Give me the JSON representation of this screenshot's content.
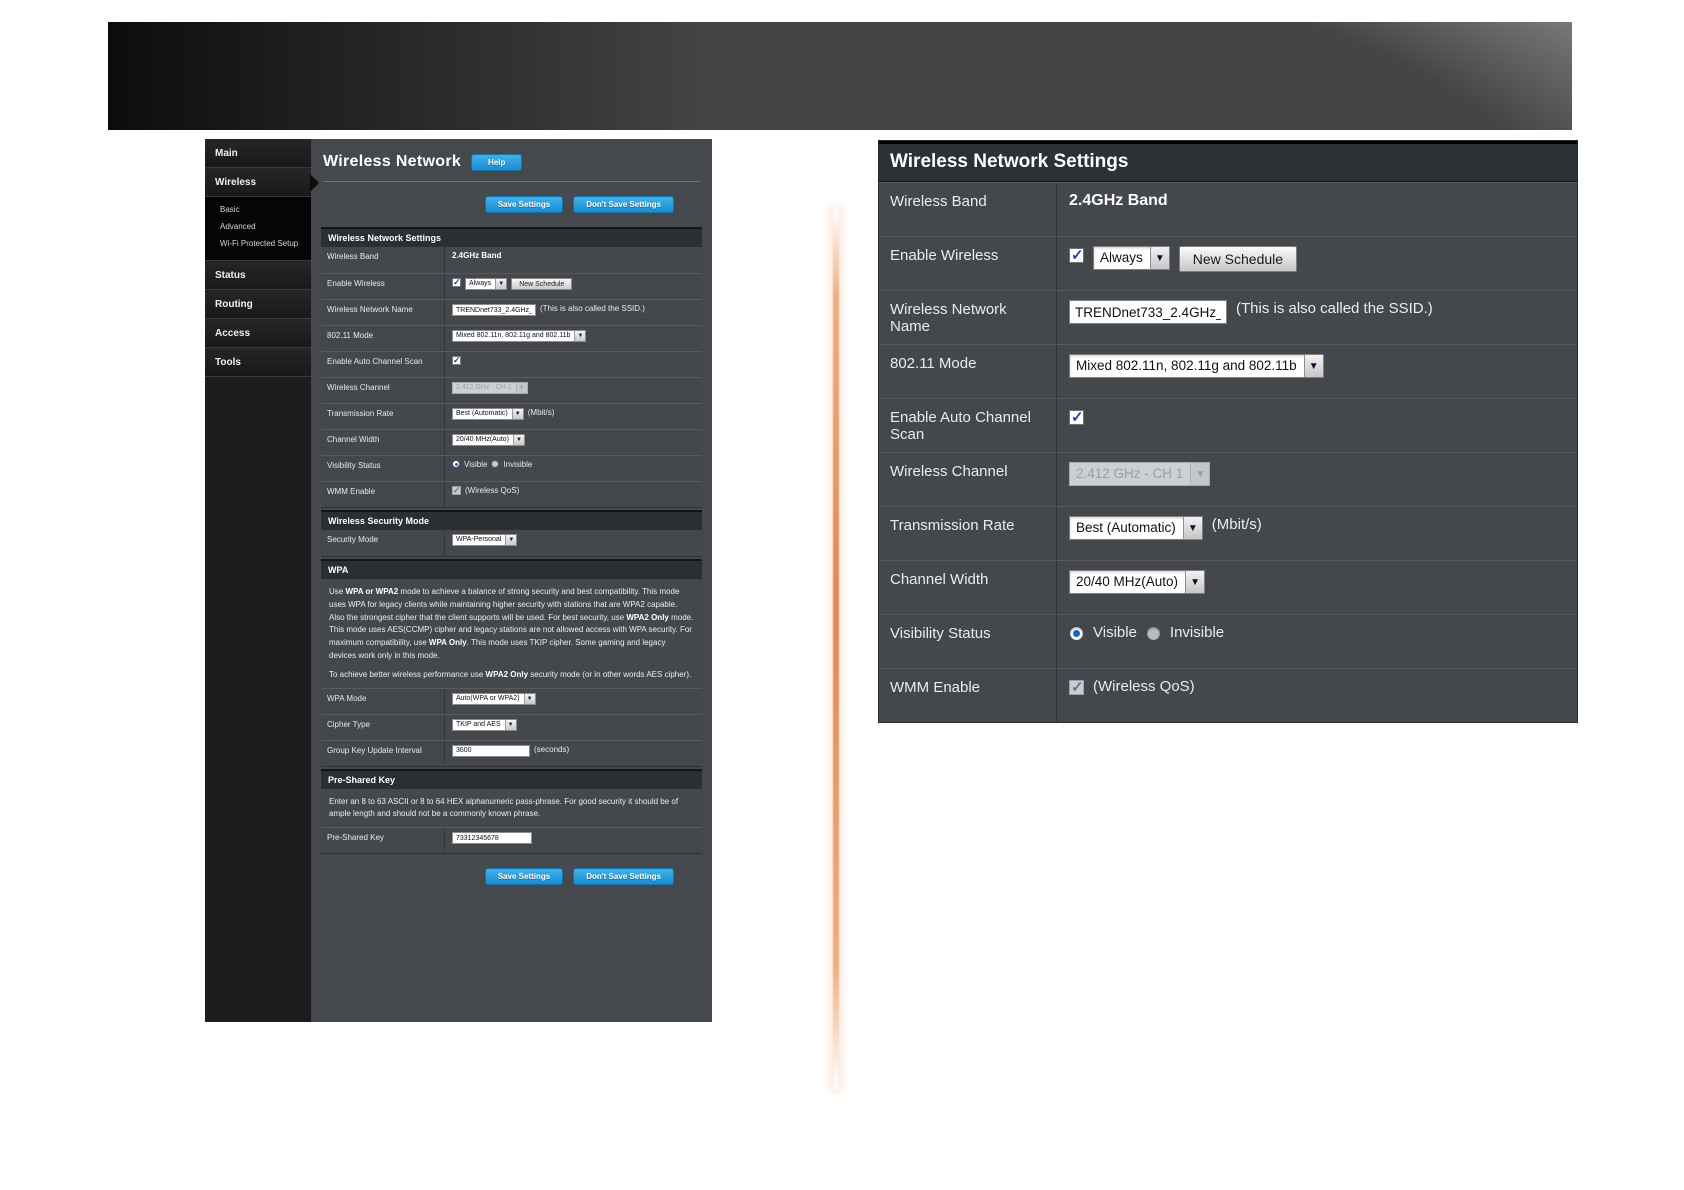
{
  "colors": {
    "accent_blue": "#2196d6",
    "panel_bg": "#44484d",
    "header_bg": "#2d3035",
    "stripe_orange": "#df8a50"
  },
  "sidebar": {
    "items": [
      {
        "label": "Main"
      },
      {
        "label": "Wireless"
      },
      {
        "label": "Basic"
      },
      {
        "label": "Advanced"
      },
      {
        "label": "Wi-Fi Protected Setup"
      },
      {
        "label": "Status"
      },
      {
        "label": "Routing"
      },
      {
        "label": "Access"
      },
      {
        "label": "Tools"
      }
    ]
  },
  "page": {
    "title": "Wireless Network",
    "help_label": "Help",
    "save_label": "Save Settings",
    "dont_save_label": "Don't Save Settings"
  },
  "settings": {
    "header": "Wireless Network Settings",
    "wireless_band": {
      "label": "Wireless Band",
      "value": "2.4GHz Band"
    },
    "enable_wireless": {
      "label": "Enable Wireless",
      "checked": true,
      "dropdown_value": "Always",
      "schedule_button": "New Schedule"
    },
    "network_name": {
      "label": "Wireless Network Name",
      "value": "TRENDnet733_2.4GHz_",
      "note": "(This is also called the SSID.)"
    },
    "mode_80211": {
      "label": "802.11 Mode",
      "value": "Mixed 802.11n, 802.11g and 802.11b"
    },
    "auto_channel_scan": {
      "label": "Enable Auto Channel Scan",
      "checked": true
    },
    "wireless_channel": {
      "label": "Wireless Channel",
      "value": "2.412 GHz - CH 1",
      "disabled": true
    },
    "transmission_rate": {
      "label": "Transmission Rate",
      "value": "Best (Automatic)",
      "unit": "(Mbit/s)"
    },
    "channel_width": {
      "label": "Channel Width",
      "value": "20/40 MHz(Auto)"
    },
    "visibility_status": {
      "label": "Visibility Status",
      "option_visible": "Visible",
      "option_invisible": "Invisible",
      "selected": "Visible"
    },
    "wmm_enable": {
      "label": "WMM Enable",
      "checked": true,
      "note": "(Wireless QoS)"
    }
  },
  "security": {
    "header": "Wireless Security Mode",
    "security_mode_label": "Security Mode",
    "security_mode_value": "WPA-Personal"
  },
  "wpa": {
    "header": "WPA",
    "p1": [
      "Use ",
      "WPA or WPA2",
      " mode to achieve a balance of strong security and best compatibility. This mode uses WPA for legacy clients while maintaining higher security with stations that are WPA2 capable. Also the strongest cipher that the client supports will be used. For best security, use ",
      "WPA2 Only",
      " mode. This mode uses AES(CCMP) cipher and legacy stations are not allowed access with WPA security. For maximum compatibility, use ",
      "WPA Only",
      ". This mode uses TKIP cipher. Some gaming and legacy devices work only in this mode."
    ],
    "p2": [
      "To achieve better wireless performance use ",
      "WPA2 Only",
      " security mode (or in other words AES cipher)."
    ],
    "wpa_mode": {
      "label": "WPA Mode",
      "value": "Auto(WPA or WPA2)"
    },
    "cipher_type": {
      "label": "Cipher Type",
      "value": "TKIP and AES"
    },
    "group_key": {
      "label": "Group Key Update Interval",
      "value": "3600",
      "unit": "(seconds)"
    }
  },
  "psk": {
    "header": "Pre-Shared Key",
    "description": "Enter an 8 to 63 ASCII or 8 to 64 HEX alphanumeric pass-phrase. For good security it should be of ample length and should not be a commonly known phrase.",
    "row": {
      "label": "Pre-Shared Key",
      "value": "73312345678"
    }
  }
}
